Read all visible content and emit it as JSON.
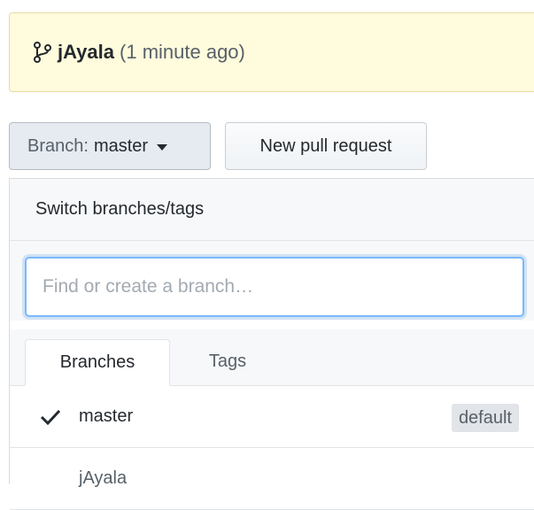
{
  "commit_notice": {
    "icon": "git-branch-icon",
    "user": "jAyala",
    "time": "(1 minute ago)"
  },
  "toolbar": {
    "branch_prefix": "Branch:",
    "branch_name": "master",
    "new_pr_label": "New pull request"
  },
  "dropdown": {
    "header": "Switch branches/tags",
    "filter_placeholder": "Find or create a branch…",
    "tabs": [
      {
        "label": "Branches",
        "active": true
      },
      {
        "label": "Tags",
        "active": false
      }
    ],
    "branches": [
      {
        "name": "master",
        "selected": true,
        "badge": "default"
      },
      {
        "name": "jAyala",
        "selected": false
      }
    ]
  },
  "colors": {
    "notice_bg": "#fffbdd",
    "focus_ring": "#79b8ff"
  }
}
